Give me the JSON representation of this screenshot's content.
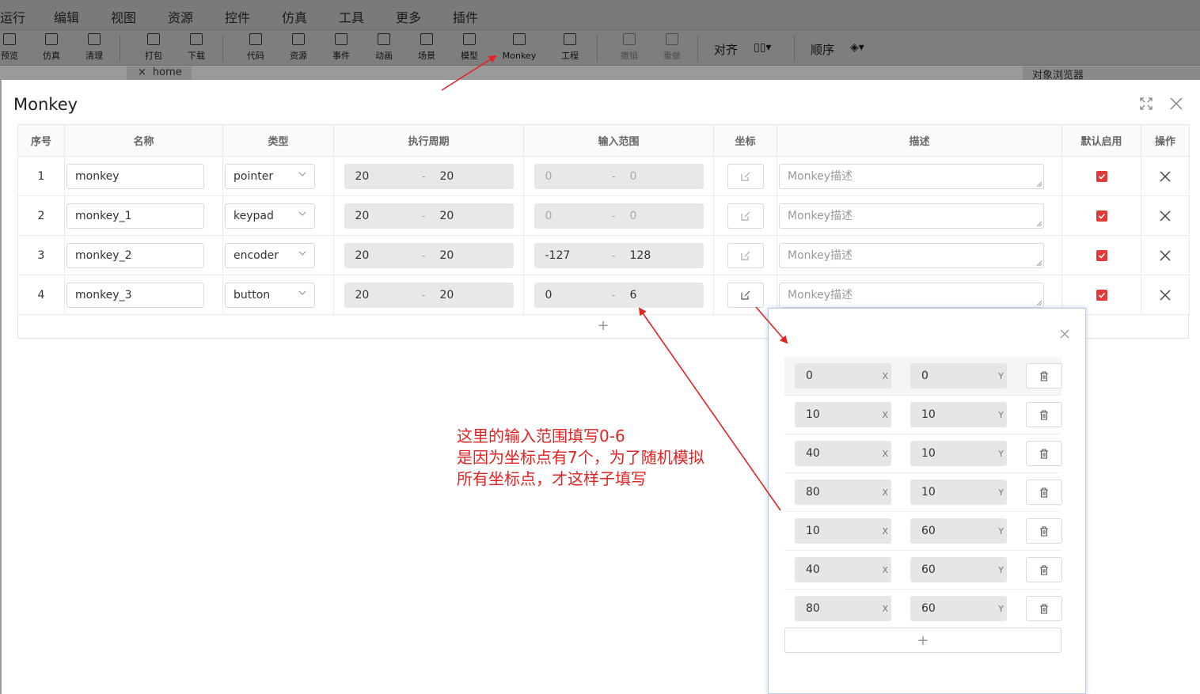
{
  "menubar": {
    "items": [
      "运行",
      "编辑",
      "视图",
      "资源",
      "控件",
      "仿真",
      "工具",
      "更多",
      "插件"
    ]
  },
  "toolbar": {
    "tools": [
      {
        "label": "预览",
        "icon": "eye-icon"
      },
      {
        "label": "仿真",
        "icon": "simulate-icon"
      },
      {
        "label": "清理",
        "icon": "broom-icon"
      },
      {
        "label": "打包",
        "icon": "package-icon"
      },
      {
        "label": "下载",
        "icon": "download-icon"
      },
      {
        "label": "代码",
        "icon": "code-icon"
      },
      {
        "label": "资源",
        "icon": "image-icon"
      },
      {
        "label": "事件",
        "icon": "touch-icon"
      },
      {
        "label": "动画",
        "icon": "star-icon"
      },
      {
        "label": "场景",
        "icon": "scene-icon"
      },
      {
        "label": "模型",
        "icon": "model-icon"
      },
      {
        "label": "Monkey",
        "icon": "monkey-icon"
      },
      {
        "label": "工程",
        "icon": "project-icon"
      },
      {
        "label": "撤销",
        "icon": "undo-icon"
      },
      {
        "label": "重做",
        "icon": "redo-icon"
      }
    ],
    "align_label": "对齐",
    "order_label": "顺序"
  },
  "tabs": {
    "home": "home",
    "close_glyph": "×"
  },
  "object_browser": "对象浏览器",
  "modal": {
    "title": "Monkey",
    "columns": [
      "序号",
      "名称",
      "类型",
      "执行周期",
      "输入范围",
      "坐标",
      "描述",
      "默认启用",
      "操作"
    ],
    "rows": [
      {
        "index": "1",
        "name": "monkey",
        "type": "pointer",
        "period_min": "20",
        "period_max": "20",
        "range_min": "0",
        "range_max": "0",
        "description": "Monkey描述",
        "enabled": true
      },
      {
        "index": "2",
        "name": "monkey_1",
        "type": "keypad",
        "period_min": "20",
        "period_max": "20",
        "range_min": "0",
        "range_max": "0",
        "description": "Monkey描述",
        "enabled": true
      },
      {
        "index": "3",
        "name": "monkey_2",
        "type": "encoder",
        "period_min": "20",
        "period_max": "20",
        "range_min": "-127",
        "range_max": "128",
        "description": "Monkey描述",
        "enabled": true
      },
      {
        "index": "4",
        "name": "monkey_3",
        "type": "button",
        "period_min": "20",
        "period_max": "20",
        "range_min": "0",
        "range_max": "6",
        "description": "Monkey描述",
        "enabled": true
      }
    ],
    "range_separator": "-",
    "add_glyph": "+"
  },
  "coord_popover": {
    "x_suffix": "X",
    "y_suffix": "Y",
    "points": [
      {
        "x": "0",
        "y": "0"
      },
      {
        "x": "10",
        "y": "10"
      },
      {
        "x": "40",
        "y": "10"
      },
      {
        "x": "80",
        "y": "10"
      },
      {
        "x": "10",
        "y": "60"
      },
      {
        "x": "40",
        "y": "60"
      },
      {
        "x": "80",
        "y": "60"
      }
    ],
    "add_glyph": "+"
  },
  "annotation": {
    "lines": [
      "这里的输入范围填写0-6",
      "是因为坐标点有7个，为了随机模拟",
      "所有坐标点，才这样子填写"
    ],
    "color": "#e52222"
  },
  "colors": {
    "checkbox": "#e03a3a",
    "overlay": "#9a9a9a"
  }
}
